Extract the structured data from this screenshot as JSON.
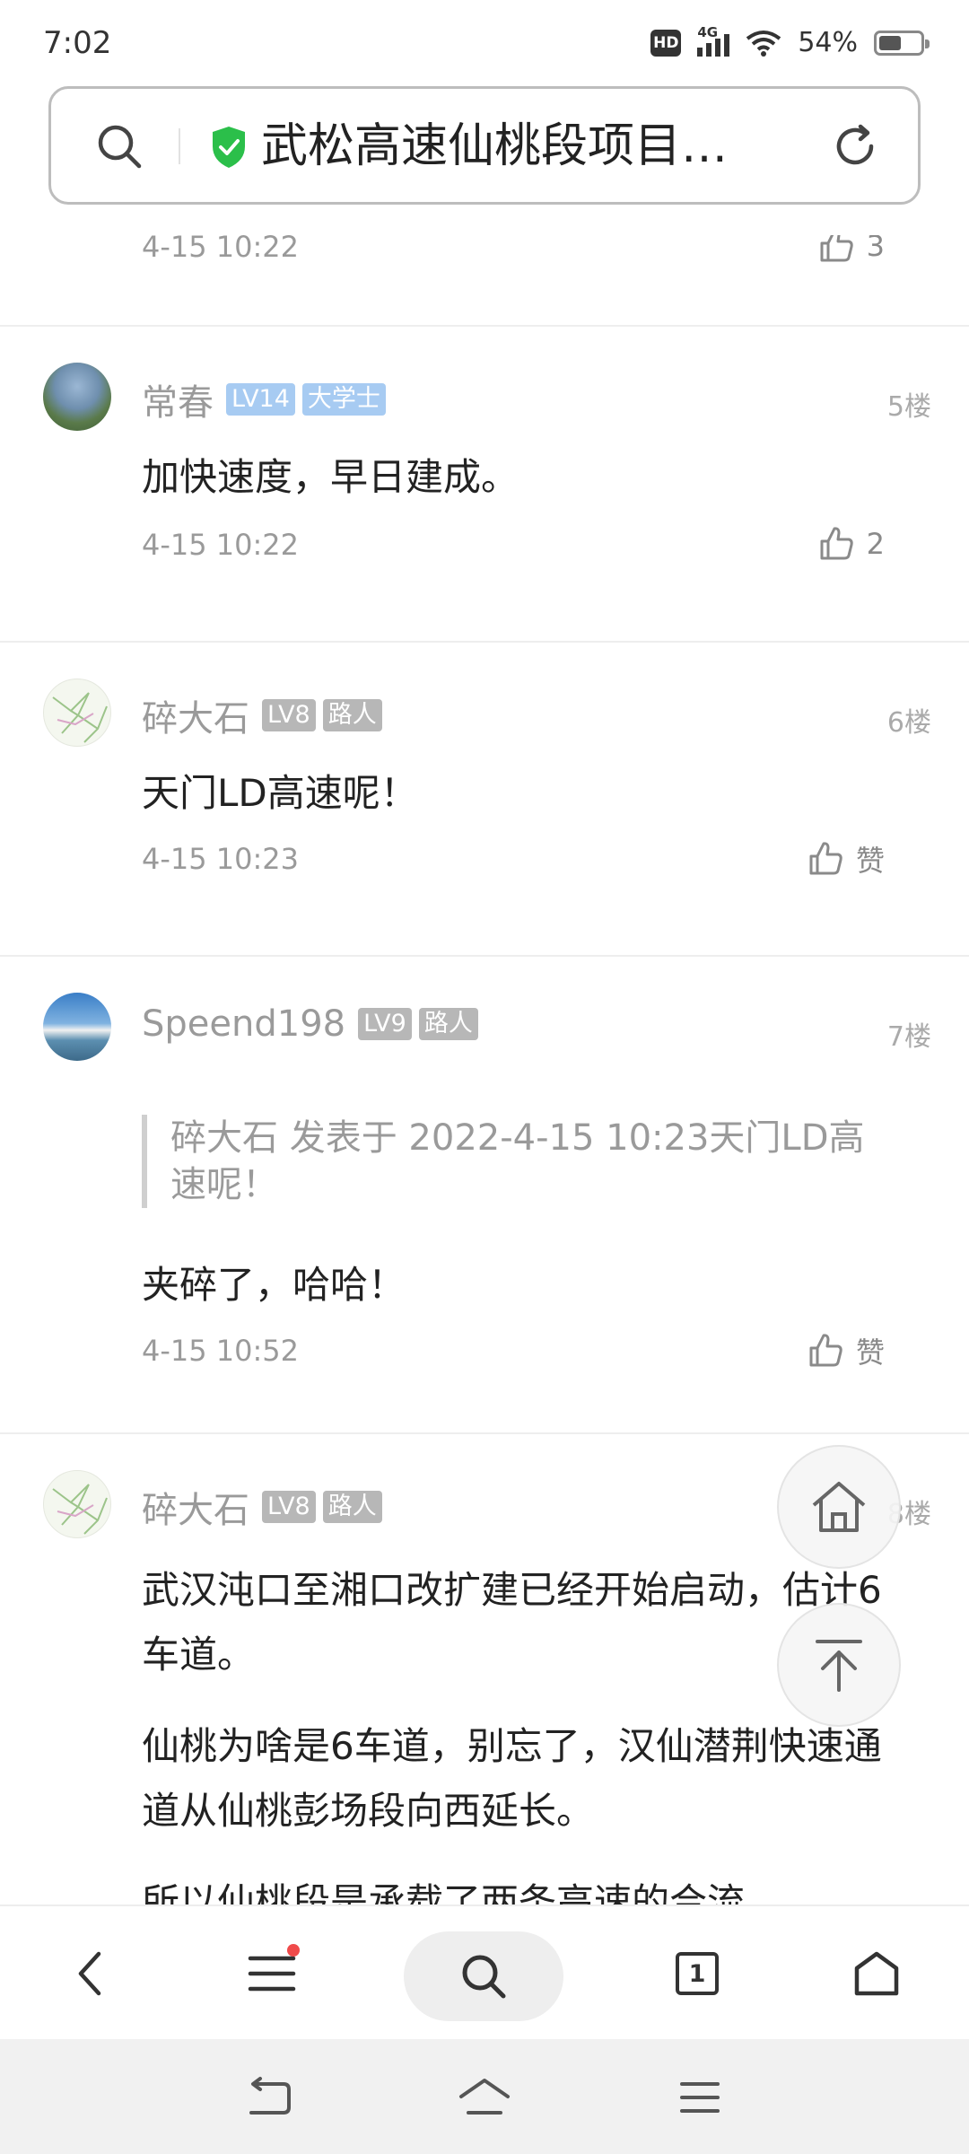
{
  "status_bar": {
    "time": "7:02",
    "hd": "HD",
    "network": "4G",
    "battery_text": "54%",
    "battery_level": 0.54
  },
  "address_bar": {
    "title": "武松高速仙桃段项目…"
  },
  "posts": [
    {
      "time": "4-15 10:22",
      "likes": "3"
    },
    {
      "username": "常春",
      "level": "LV14",
      "rank": "大学士",
      "floor": "5楼",
      "content": "加快速度，早日建成。",
      "time": "4-15 10:22",
      "likes": "2"
    },
    {
      "username": "碎大石",
      "level": "LV8",
      "rank": "路人",
      "floor": "6楼",
      "content": "天门LD高速呢！",
      "time": "4-15 10:23",
      "likes": "赞"
    },
    {
      "username": "Speend198",
      "level": "LV9",
      "rank": "路人",
      "floor": "7楼",
      "quote": "碎大石 发表于 2022-4-15 10:23天门LD高速呢！",
      "content": "夹碎了，哈哈！",
      "time": "4-15 10:52",
      "likes": "赞"
    },
    {
      "username": "碎大石",
      "level": "LV8",
      "rank": "路人",
      "floor": "8楼",
      "paragraphs": [
        "武汉沌口至湘口改扩建已经开始启动，估计6车道。",
        "仙桃为啥是6车道，别忘了，汉仙潜荆快速通道从仙桃彭场段向西延长。",
        "所以仙桃段是承载了两条高速的合流"
      ]
    }
  ],
  "toolbar": {
    "tab_count": "1"
  },
  "colors": {
    "level_blue": "#a7cbf2",
    "level_gray": "#b7b7b7",
    "shield_green": "#2bbf4a",
    "notification_red": "#f04a4a"
  }
}
